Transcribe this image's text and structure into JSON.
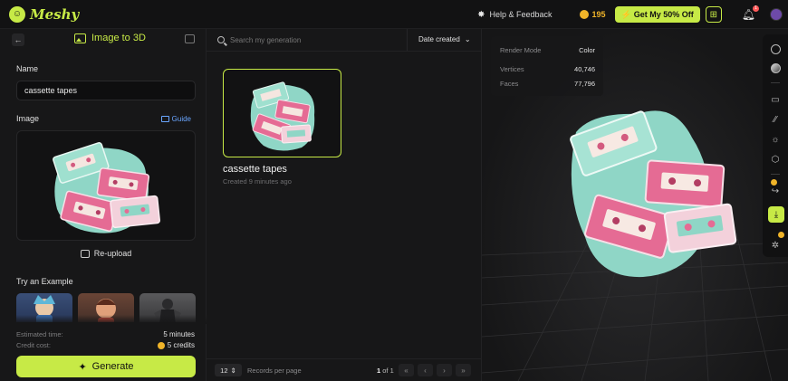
{
  "topbar": {
    "brand": "Meshy",
    "help_label": "Help & Feedback",
    "credits": "195",
    "promo_label": "Get My 50% Off",
    "notification_count": "1"
  },
  "left_panel": {
    "title": "Image to 3D",
    "name_label": "Name",
    "name_value": "cassette tapes",
    "image_label": "Image",
    "guide_label": "Guide",
    "reupload_label": "Re-upload",
    "examples_label": "Try an Example",
    "estimated_time_label": "Estimated time:",
    "estimated_time_value": "5 minutes",
    "credit_cost_label": "Credit cost:",
    "credit_cost_value": "5 credits",
    "generate_label": "Generate"
  },
  "middle_panel": {
    "search_placeholder": "Search my generation",
    "sort_label": "Date created",
    "card": {
      "title": "cassette tapes",
      "subtitle": "Created 9 minutes ago"
    },
    "pager": {
      "per_page": "12",
      "per_page_label": "Records per page",
      "current": "1",
      "of_label": "of 1"
    }
  },
  "viewer": {
    "stats": [
      {
        "key": "Render Mode",
        "value": "Color"
      },
      {
        "key": "Vertices",
        "value": "40,746"
      },
      {
        "key": "Faces",
        "value": "77,796"
      }
    ]
  },
  "colors": {
    "accent": "#c7ea46",
    "coin": "#f0b429",
    "link": "#6aa6ff",
    "mint": "#8fd6c6",
    "pink": "#e56b94"
  }
}
